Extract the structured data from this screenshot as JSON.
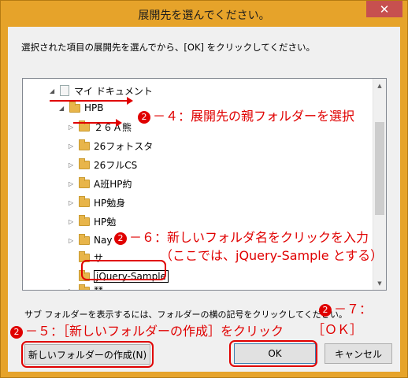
{
  "window": {
    "title": "展開先を選んでください。",
    "close_glyph": "✕"
  },
  "instruction": "選択された項目の展開先を選んでから、[OK] をクリックしてください。",
  "tree": {
    "items": [
      {
        "label": "マイ ドキュメント",
        "tri": "◢"
      },
      {
        "label": "HPB",
        "tri": "◢"
      },
      {
        "label": "２６Ａ熊",
        "tri": "▷"
      },
      {
        "label": "26フォトスタ",
        "tri": "▷"
      },
      {
        "label": "26フルCS",
        "tri": "▷"
      },
      {
        "label": "A班HP約",
        "tri": "▷"
      },
      {
        "label": "HP勉身",
        "tri": "▷"
      },
      {
        "label": "HP勉",
        "tri": "▷"
      },
      {
        "label": "Nay",
        "tri": "▷"
      },
      {
        "label": "サ",
        "tri": ""
      },
      {
        "label": "jQuery-Sample",
        "tri": ""
      },
      {
        "label": "琴",
        "tri": "▷"
      }
    ]
  },
  "subfolder_hint": "サブ フォルダーを表示するには、フォルダーの横の記号をクリックしてください。",
  "buttons": {
    "new_folder": "新しいフォルダーの作成(N)",
    "ok": "OK",
    "cancel": "キャンセル"
  },
  "annotations": {
    "step4": {
      "num": "2",
      "text": "－４：展開先の親フォルダーを選択"
    },
    "step6_line1": {
      "num": "2",
      "text": "－６：新しいフォルダ名をクリックを入力"
    },
    "step6_line2": "（ここでは、jQuery-Sample とする）",
    "step7": {
      "num": "2",
      "text": "－７："
    },
    "step7_ok": "［ＯＫ］",
    "step5": {
      "num": "2",
      "text": "－５：［新しいフォルダーの作成］をクリック"
    }
  },
  "colors": {
    "frame": "#e6a32a",
    "annotation_red": "#e00000",
    "close_button": "#c7504f"
  }
}
